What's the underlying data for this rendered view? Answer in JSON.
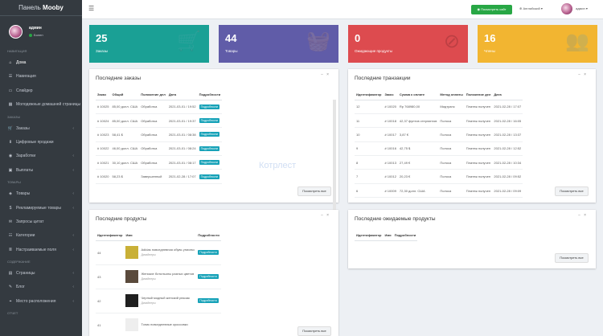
{
  "brand": {
    "pre": "Панель",
    "name": "Mooby"
  },
  "user": {
    "name": "админ",
    "status": "Болен"
  },
  "sidebar": [
    {
      "type": "head",
      "label": "НАВИГАЦИЯ"
    },
    {
      "type": "item",
      "label": "Дома",
      "icon": "⌂",
      "active": true
    },
    {
      "type": "item",
      "label": "Навигация",
      "icon": "☰"
    },
    {
      "type": "item",
      "label": "Слайдер",
      "icon": "▭"
    },
    {
      "type": "item",
      "label": "Молодежные домашней страницы",
      "icon": "▦"
    },
    {
      "type": "head",
      "label": "ЗАКАЗЫ"
    },
    {
      "type": "item",
      "label": "Заказы",
      "icon": "🛒",
      "chev": true
    },
    {
      "type": "item",
      "label": "Цифровые продажи",
      "icon": "⬇"
    },
    {
      "type": "item",
      "label": "Заработки",
      "icon": "◉",
      "chev": true
    },
    {
      "type": "item",
      "label": "Выплаты",
      "icon": "▣",
      "chev": true
    },
    {
      "type": "head",
      "label": "ТОВАРЫ"
    },
    {
      "type": "item",
      "label": "Товары",
      "icon": "◈",
      "chev": true
    },
    {
      "type": "item",
      "label": "Рекламируемые товары",
      "icon": "$",
      "chev": true
    },
    {
      "type": "item",
      "label": "Запросы цитат",
      "icon": "✉"
    },
    {
      "type": "item",
      "label": "Категории",
      "icon": "☷",
      "chev": true
    },
    {
      "type": "item",
      "label": "Настраиваемые поля",
      "icon": "≣",
      "chev": true
    },
    {
      "type": "head",
      "label": "СОДЕРЖАНИЕ"
    },
    {
      "type": "item",
      "label": "Страницы",
      "icon": "▤",
      "chev": true
    },
    {
      "type": "item",
      "label": "Блог",
      "icon": "✎",
      "chev": true
    },
    {
      "type": "item",
      "label": "Место расположения",
      "icon": "⌖",
      "chev": true
    },
    {
      "type": "head",
      "label": "ОТЧЕТ"
    }
  ],
  "topbar": {
    "view_site": "Посмотреть сайт",
    "language": "Английский",
    "user": "админ"
  },
  "stats": [
    {
      "value": "25",
      "label": "Заказы",
      "color": "#1aa095",
      "icon": "🛒"
    },
    {
      "value": "44",
      "label": "Товары",
      "color": "#605ca8",
      "icon": "🧺"
    },
    {
      "value": "0",
      "label": "Ожидающие продукты",
      "color": "#dd4b4f",
      "icon": "⊘"
    },
    {
      "value": "16",
      "label": "Члены",
      "color": "#f2b531",
      "icon": "👥"
    }
  ],
  "orders": {
    "title": "Последние заказы",
    "columns": [
      "Заказ",
      "Общий",
      "Положение дел",
      "Дата",
      "Подробности"
    ],
    "rows": [
      [
        "# 10025",
        "85,00 долл. США",
        "Обработка",
        "2021-03-01 / 19:52",
        "Подробности"
      ],
      [
        "# 10024",
        "85,00 долл. США",
        "Обработка",
        "2021-03-01 / 19:37",
        "Подробности"
      ],
      [
        "# 10023",
        "58,41 $",
        "Обработка",
        "2021-03-01 / 08:38",
        "Подробности"
      ],
      [
        "# 10022",
        "46,00 долл. США",
        "Обработка",
        "2021-03-01 / 08:24",
        "Подробности"
      ],
      [
        "# 10021",
        "30,10 долл. США",
        "Обработка",
        "2021-03-01 / 08:17",
        "Подробности"
      ],
      [
        "# 10020",
        "58,23 $",
        "Завершенный",
        "2021-02-28 / 17:07",
        "Подробности"
      ]
    ],
    "more": "Посмотреть все"
  },
  "transactions": {
    "title": "Последние транзакции",
    "columns": [
      "Идентификатор",
      "Заказ",
      "Сумма к оплате",
      "Метод оплаты",
      "Положение дел",
      "Дата"
    ],
    "rows": [
      [
        "12",
        "# 10020",
        "Rp 768980,00",
        "Мидтранс",
        "Платеж получен",
        "2021-02-28 / 17:07"
      ],
      [
        "11",
        "# 10018",
        "42,37 фунтов стерлингов",
        "Полоса",
        "Платеж получен",
        "2021-02-28 / 16:05"
      ],
      [
        "10",
        "# 10017",
        "3,87 €",
        "Полоса",
        "Платеж получен",
        "2021-02-28 / 13:37"
      ],
      [
        "9",
        "# 10016",
        "42,75 $",
        "Полоса",
        "Платеж получен",
        "2021-02-28 / 12:52"
      ],
      [
        "8",
        "# 10013",
        "27,49 €",
        "Полоса",
        "Платеж получен",
        "2021-02-28 / 10:34"
      ],
      [
        "7",
        "# 10012",
        "20,23 €",
        "Полоса",
        "Платеж получен",
        "2021-02-28 / 09:52"
      ],
      [
        "6",
        "# 10009",
        "72,30 долл. США",
        "Полоса",
        "Платеж получен",
        "2021-02-28 / 09:09"
      ]
    ],
    "more": "Посмотреть все"
  },
  "products": {
    "title": "Последние продукты",
    "columns": [
      "Идентификатор",
      "Имя",
      "Подробности"
    ],
    "rows": [
      {
        "id": "44",
        "name": "Adidas повседневная обувь унисекс",
        "cat": "Дизайнеры",
        "color": "#c9b037",
        "detail": "Подробности"
      },
      {
        "id": "43",
        "name": "Женские ботильоны разных цветов",
        "cat": "Дизайнеры",
        "color": "#5a4a3c",
        "detail": "Подробности"
      },
      {
        "id": "42",
        "name": "Черный модный женский рюкзак",
        "cat": "Дизайнеры",
        "color": "#1f1f1f",
        "detail": "Подробности"
      },
      {
        "id": "41",
        "name": "Топик повседневные кроссовки",
        "cat": "",
        "color": "#eeeeee",
        "detail": ""
      }
    ],
    "more": "Посмотреть все"
  },
  "pending": {
    "title": "Последние ожидаемые продукты",
    "columns": [
      "Идентификатор",
      "Имя",
      "Подробности"
    ],
    "more": "Посмотреть все"
  },
  "watermark": "Котрлест"
}
